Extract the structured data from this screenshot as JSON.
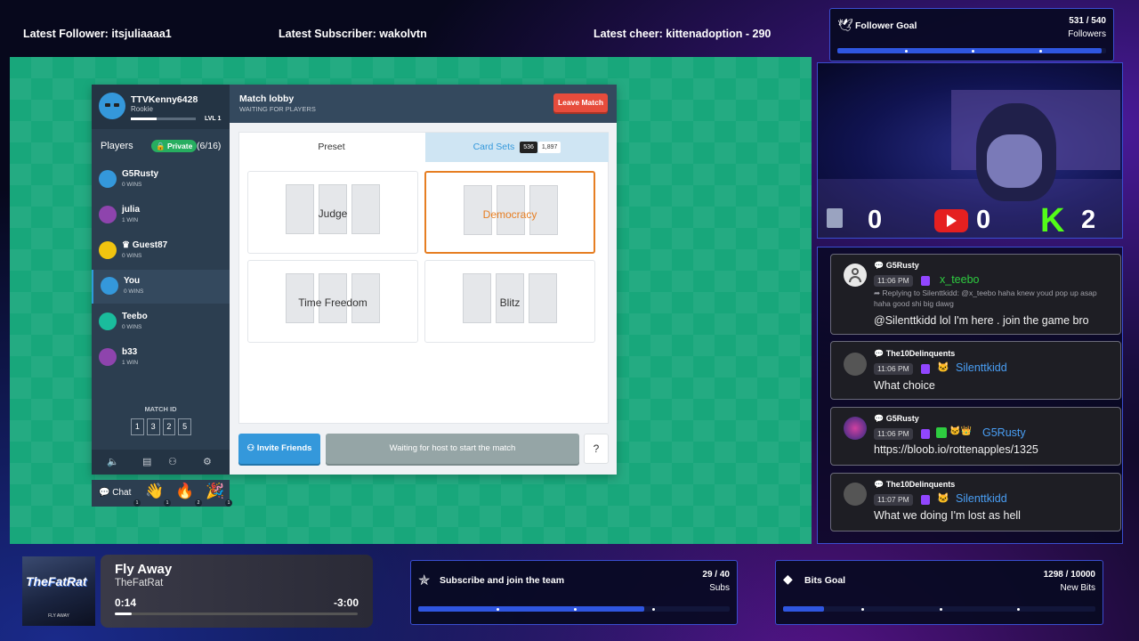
{
  "topbar": {
    "follower": "Latest Follower: itsjuliaaaa1",
    "subscriber": "Latest Subscriber: wakolvtn",
    "cheer": "Latest cheer: kittenadoption - 290"
  },
  "follower_goal": {
    "title": "Follower Goal",
    "count": "531 / 540",
    "unit": "Followers",
    "progress": 0.983
  },
  "lobby": {
    "profile": {
      "name": "TTVKenny6428",
      "rank": "Rookie",
      "level": "LVL 1",
      "xp_progress": 0.4
    },
    "players_label": "Players",
    "private_label": "🔒 Private",
    "count": "(6/16)",
    "players": [
      {
        "name": "G5Rusty",
        "wins": "0 WINS",
        "color": "#3498db"
      },
      {
        "name": "julia",
        "wins": "1 WIN",
        "color": "#8e44ad"
      },
      {
        "name": "♛ Guest87",
        "wins": "0 WINS",
        "color": "#f1c40f"
      },
      {
        "name": "You",
        "wins": "0 WINS",
        "color": "#3498db"
      },
      {
        "name": "Teebo",
        "wins": "0 WINS",
        "color": "#1abc9c"
      },
      {
        "name": "b33",
        "wins": "1 WIN",
        "color": "#8e44ad"
      }
    ],
    "match_id_label": "MATCH ID",
    "match_id": [
      "1",
      "3",
      "2",
      "5"
    ],
    "header_title": "Match lobby",
    "header_subtitle": "WAITING FOR PLAYERS",
    "leave_label": "Leave Match",
    "tab_preset": "Preset",
    "tab_card_sets": "Card Sets",
    "card_set_count_a": "536",
    "card_set_count_b": "1,897",
    "modes": [
      "Judge",
      "Democracy",
      "Time Freedom",
      "Blitz"
    ],
    "selected_mode": "Democracy",
    "invite_label": "Invite Friends",
    "waiting_label": "Waiting for host to start the match",
    "help_label": "?",
    "chat_label": "Chat",
    "emote_counts": [
      "1",
      "1",
      "2",
      "1"
    ]
  },
  "webcam": {
    "scores": [
      "0",
      "0",
      "2"
    ]
  },
  "chat": [
    {
      "header": "G5Rusty",
      "time": "11:06 PM",
      "user": "x_teebo",
      "user_color": "#2ecc40",
      "reply": "➦ Replying to Silenttkidd: @x_teebo haha knew youd pop up asap haha good shi big dawg",
      "text": "@Silenttkidd lol I'm here . join the game bro"
    },
    {
      "header": "The10Delinquents",
      "time": "11:06 PM",
      "user": "Silenttkidd",
      "user_color": "#4a9ff5",
      "text": "What choice"
    },
    {
      "header": "G5Rusty",
      "time": "11:06 PM",
      "user": "G5Rusty",
      "user_color": "#4a9ff5",
      "text": "https://bloob.io/rottenapples/1325"
    },
    {
      "header": "The10Delinquents",
      "time": "11:07 PM",
      "user": "Silenttkidd",
      "user_color": "#4a9ff5",
      "text": "What we doing I'm lost as hell"
    }
  ],
  "music": {
    "song": "Fly Away",
    "artist": "TheFatRat",
    "current": "0:14",
    "remaining": "-3:00",
    "progress": 0.07,
    "album_text": "TheFatRat",
    "album_sub": "FLY AWAY"
  },
  "sub_goal": {
    "title": "Subscribe and join the team",
    "count": "29 / 40",
    "unit": "Subs",
    "progress": 0.725
  },
  "bits_goal": {
    "title": "Bits Goal",
    "count": "1298 / 10000",
    "unit": "New Bits",
    "progress": 0.13
  }
}
